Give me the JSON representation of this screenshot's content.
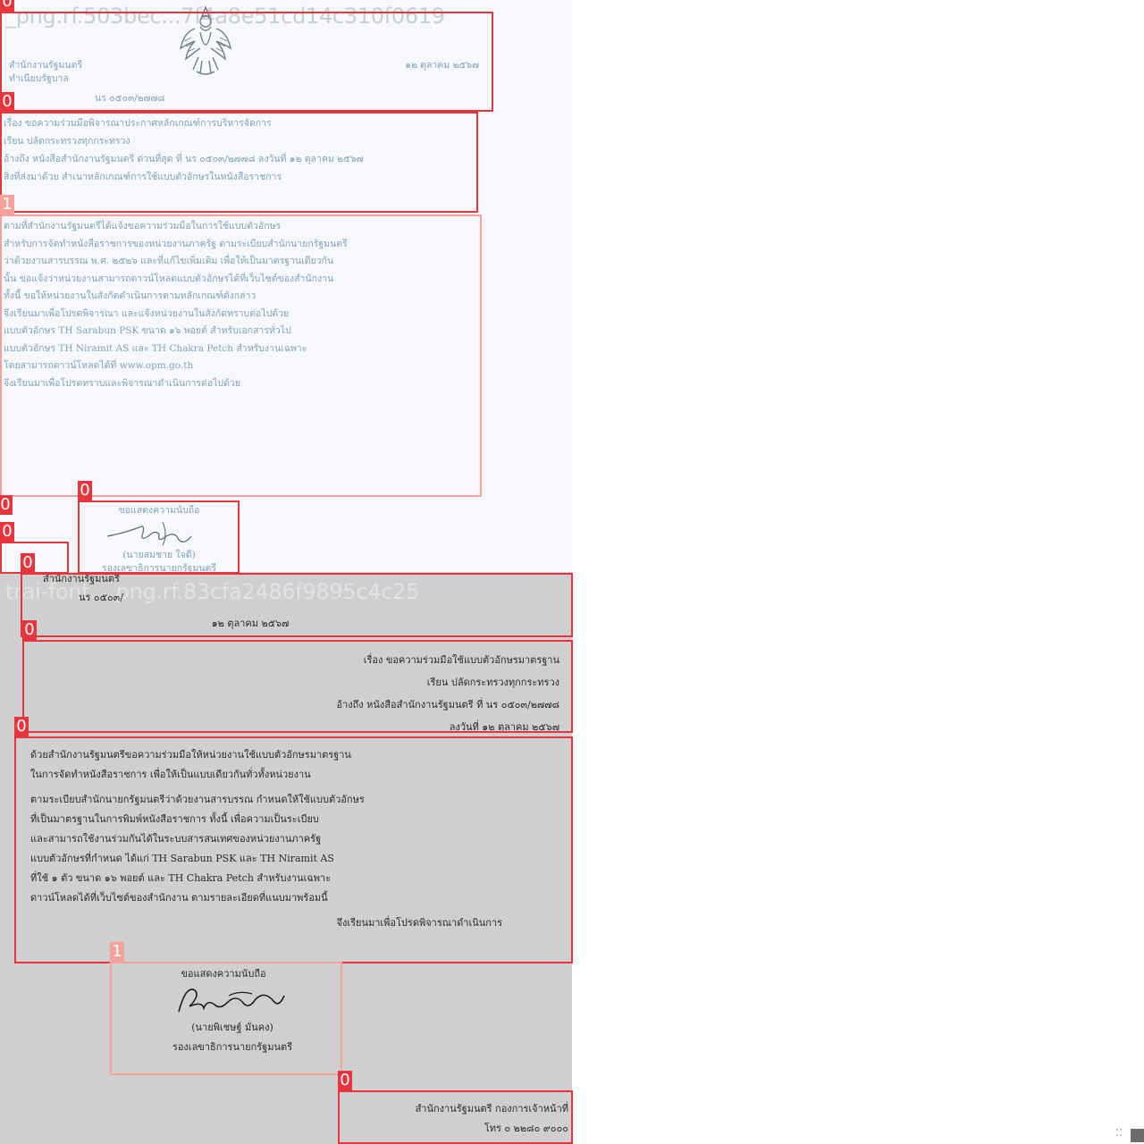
{
  "images": [
    {
      "watermark": "_png.rf.503bec...7f4a8e51cd14c310f0619",
      "header": {
        "left": [
          "สำนักงานรัฐมนตรี",
          "ทำเนียบรัฐบาล"
        ],
        "right": "๑๒ ตุลาคม ๒๕๖๗",
        "ref": "นร ๐๕๐๓/๒๗๗๘"
      },
      "meta_lines": [
        "เรื่อง ขอความร่วมมือพิจารณาประกาศหลักเกณฑ์การบริหารจัดการ",
        "เรียน ปลัดกระทรวงทุกกระทรวง",
        "อ้างถึง หนังสือสำนักงานรัฐมนตรี ด่วนที่สุด ที่ นร ๐๕๐๓/๒๗๗๘ ลงวันที่ ๑๒ ตุลาคม ๒๕๖๗",
        "สิ่งที่ส่งมาด้วย สำเนาหลักเกณฑ์การใช้แบบตัวอักษรในหนังสือราชการ"
      ],
      "body_lines": [
        "ตามที่สำนักงานรัฐมนตรีได้แจ้งขอความร่วมมือในการใช้แบบตัวอักษร",
        "สำหรับการจัดทำหนังสือราชการของหน่วยงานภาครัฐ ตามระเบียบสำนักนายกรัฐมนตรี",
        "ว่าด้วยงานสารบรรณ พ.ศ. ๒๕๒๖ และที่แก้ไขเพิ่มเติม เพื่อให้เป็นมาตรฐานเดียวกัน",
        "นั้น ขอแจ้งว่าหน่วยงานสามารถดาวน์โหลดแบบตัวอักษรได้ที่เว็บไซต์ของสำนักงาน",
        "ทั้งนี้ ขอให้หน่วยงานในสังกัดดำเนินการตามหลักเกณฑ์ดังกล่าว",
        "",
        "จึงเรียนมาเพื่อโปรดพิจารณา และแจ้งหน่วยงานในสังกัดทราบต่อไปด้วย",
        "แบบตัวอักษร TH Sarabun PSK ขนาด ๑๖ พอยต์ สำหรับเอกสารทั่วไป",
        "แบบตัวอักษร TH Niramit AS และ TH Chakra Petch สำหรับงานเฉพาะ",
        "โดยสามารถดาวน์โหลดได้ที่ www.opm.go.th",
        "จึงเรียนมาเพื่อโปรดทราบและพิจารณาดำเนินการต่อไปด้วย"
      ],
      "signature": {
        "closing": "ขอแสดงความนับถือ",
        "name": "(นายสมชาย ใจดี)",
        "title": "รองเลขาธิการนายกรัฐมนตรี"
      }
    },
    {
      "watermark": "trai-font....png.rf.83cfa2486f9895c4c25",
      "header": [
        "สำนักงานรัฐมนตรี",
        "นร ๐๕๐๓/",
        "๑๒ ตุลาคม ๒๕๖๗"
      ],
      "meta_lines": [
        "เรื่อง ขอความร่วมมือใช้แบบตัวอักษรมาตรฐาน",
        "เรียน ปลัดกระทรวงทุกกระทรวง",
        "อ้างถึง หนังสือสำนักงานรัฐมนตรี ที่ นร ๐๕๐๓/๒๗๗๘",
        "ลงวันที่ ๑๒ ตุลาคม ๒๕๖๗"
      ],
      "body_lines": [
        "ด้วยสำนักงานรัฐมนตรีขอความร่วมมือให้หน่วยงานใช้แบบตัวอักษรมาตรฐาน",
        "ในการจัดทำหนังสือราชการ เพื่อให้เป็นแบบเดียวกันทั่วทั้งหน่วยงาน",
        "",
        "ตามระเบียบสำนักนายกรัฐมนตรีว่าด้วยงานสารบรรณ กำหนดให้ใช้แบบตัวอักษร",
        "ที่เป็นมาตรฐานในการพิมพ์หนังสือราชการ ทั้งนี้ เพื่อความเป็นระเบียบ",
        "และสามารถใช้งานร่วมกันได้ในระบบสารสนเทศของหน่วยงานภาครัฐ",
        "แบบตัวอักษรที่กำหนด ได้แก่ TH Sarabun PSK และ TH Niramit AS",
        "ที่ใช้ ๑ ตัว ขนาด ๑๖ พอยต์ และ TH Chakra Petch สำหรับงานเฉพาะ",
        "ดาวน์โหลดได้ที่เว็บไซต์ของสำนักงาน ตามรายละเอียดที่แนบมาพร้อมนี้",
        "",
        "จึงเรียนมาเพื่อโปรดพิจารณาดำเนินการ"
      ],
      "signature": {
        "closing": "ขอแสดงความนับถือ",
        "name": "(นายพิเชษฐ์ มั่นคง)",
        "title": "รองเลขาธิการนายกรัฐมนตรี"
      },
      "contact_lines": [
        "สำนักงานรัฐมนตรี กองการเจ้าหน้าที่",
        "โทร ๐ ๒๒๘๐ ๙๐๐๐"
      ]
    }
  ],
  "detections": [
    {
      "label": "0",
      "class": "c0"
    },
    {
      "label": "0",
      "class": "c0"
    },
    {
      "label": "1",
      "class": "c1"
    },
    {
      "label": "0",
      "class": "c0"
    },
    {
      "label": "0",
      "class": "c0"
    },
    {
      "label": "0",
      "class": "c0"
    },
    {
      "label": "0",
      "class": "c0"
    },
    {
      "label": "0",
      "class": "c0"
    },
    {
      "label": "1",
      "class": "c1"
    },
    {
      "label": "0",
      "class": "c0"
    },
    {
      "label": "0",
      "class": "c0"
    }
  ],
  "colors": {
    "class_0": "#e8343c",
    "class_1": "#f5a19c",
    "panel_top_bg": "#f7f8fb",
    "panel_bottom_bg": "#cfcfcf"
  }
}
